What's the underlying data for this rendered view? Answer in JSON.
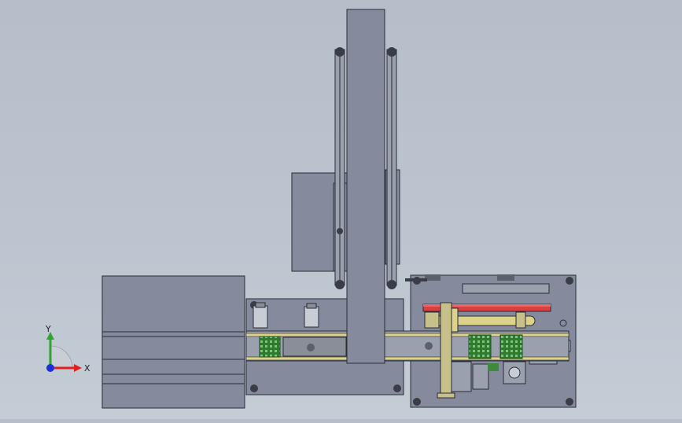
{
  "viewport": {
    "background_top": "#b6bec9",
    "background_bottom": "#c4ccd6"
  },
  "triad": {
    "x_label": "X",
    "y_label": "Y",
    "x_color": "#e0201c",
    "y_color": "#2fa52f",
    "z_color": "#1c2fd8"
  },
  "colors": {
    "body": "#858b9d",
    "body_dark": "#6e7486",
    "edge": "#2a2d36",
    "rail_yellow": "#dcd28a",
    "circuit_green": "#3d8a3d",
    "red_bar": "#d94040"
  }
}
